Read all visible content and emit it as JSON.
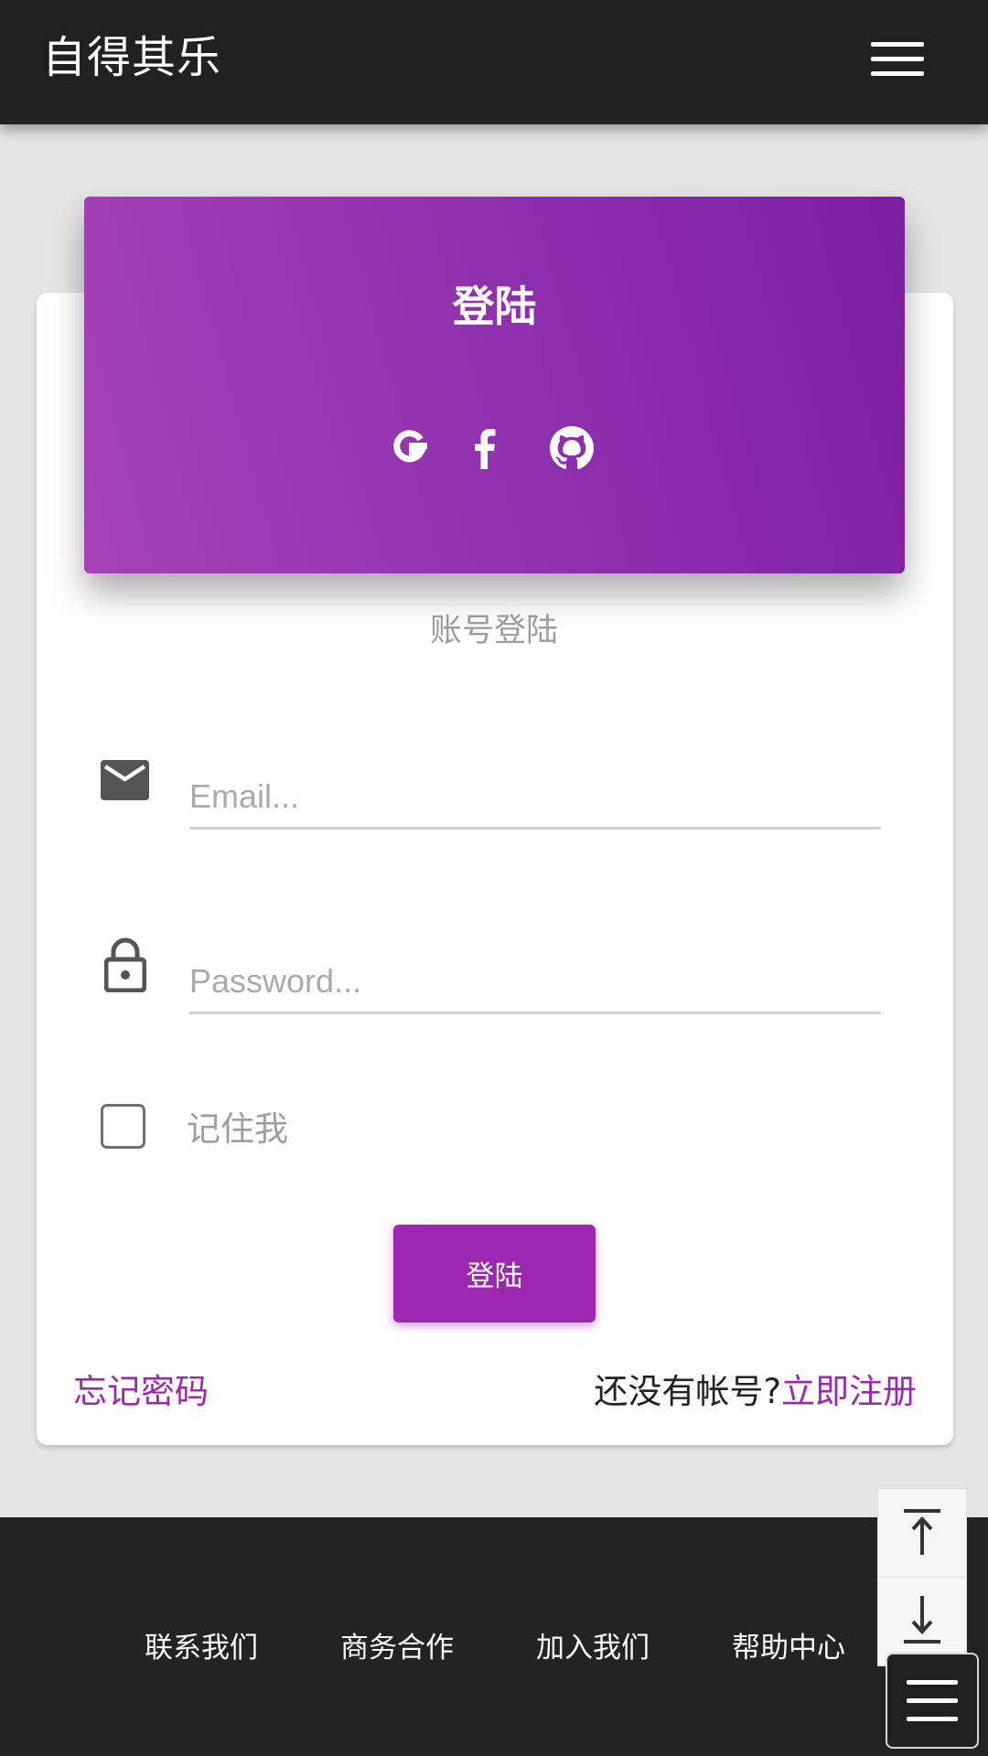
{
  "app": {
    "brand": "自得其乐",
    "menu_icon": "hamburger-menu-icon"
  },
  "login_card": {
    "title": "登陆",
    "social_icons": [
      "google-icon",
      "facebook-icon",
      "github-icon"
    ],
    "subtitle": "账号登陆",
    "email": {
      "icon": "mail-icon",
      "placeholder": "Email...",
      "value": ""
    },
    "password": {
      "icon": "lock-icon",
      "placeholder": "Password...",
      "value": ""
    },
    "remember_label": "记住我",
    "remember_checked": false,
    "submit_label": "登陆",
    "forgot_label": "忘记密码",
    "signup_prompt": "还没有帐号?",
    "signup_label": "立即注册"
  },
  "footer": {
    "links": [
      "联系我们",
      "商务合作",
      "加入我们",
      "帮助中心"
    ]
  },
  "floating": {
    "scroll_top_icon": "scroll-to-top-icon",
    "scroll_bottom_icon": "scroll-to-bottom-icon",
    "menu_icon": "menu-icon"
  },
  "colors": {
    "accent": "#9c27b0",
    "topbar": "#212121",
    "page_bg": "#e5e5e5",
    "header_gradient_start": "#a542b7",
    "header_gradient_end": "#7b1fa2"
  }
}
